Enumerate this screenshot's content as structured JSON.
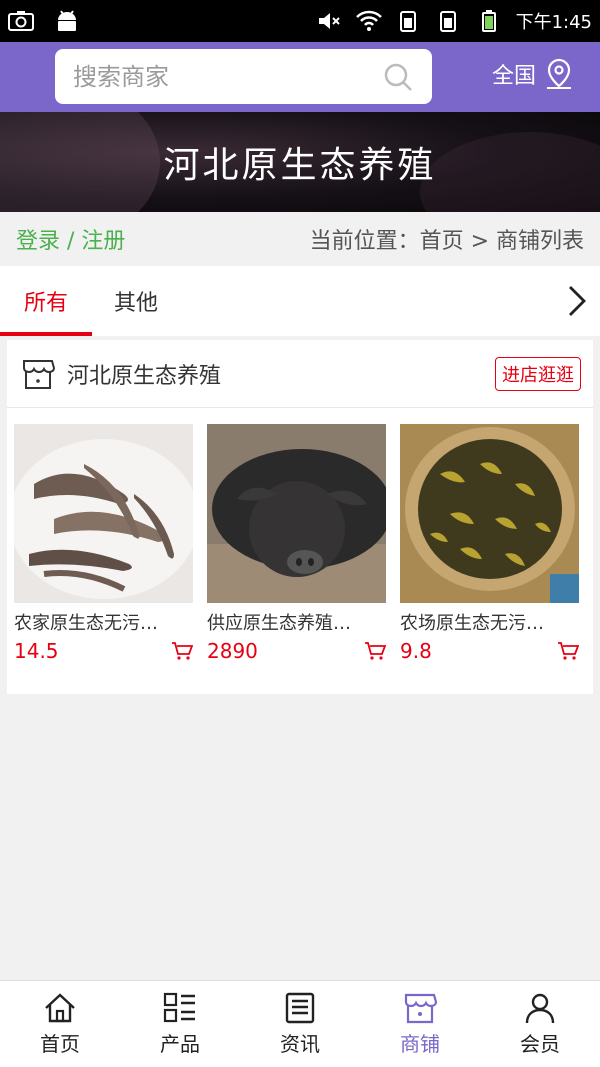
{
  "status": {
    "time": "下午1:45"
  },
  "header": {
    "search_placeholder": "搜索商家",
    "region_label": "全国"
  },
  "banner": {
    "title": "河北原生态养殖"
  },
  "crumbrow": {
    "login_label": "登录 / 注册",
    "breadcrumb": "当前位置：首页 > 商铺列表"
  },
  "tabs": [
    {
      "label": "所有",
      "active": true
    },
    {
      "label": "其他",
      "active": false
    }
  ],
  "shop": {
    "name": "河北原生态养殖",
    "enter_label": "进店逛逛",
    "products": [
      {
        "name": "农家原生态无污…",
        "price": "14.5"
      },
      {
        "name": "供应原生态养殖…",
        "price": "2890"
      },
      {
        "name": "农场原生态无污…",
        "price": "9.8"
      }
    ]
  },
  "bottom_nav": [
    {
      "label": "首页",
      "icon": "home-icon"
    },
    {
      "label": "产品",
      "icon": "list-icon"
    },
    {
      "label": "资讯",
      "icon": "news-icon"
    },
    {
      "label": "商铺",
      "icon": "shop-icon",
      "active": true
    },
    {
      "label": "会员",
      "icon": "user-icon"
    }
  ],
  "colors": {
    "accent": "#7b67c9",
    "red": "#e60012",
    "green": "#4bb04e"
  }
}
